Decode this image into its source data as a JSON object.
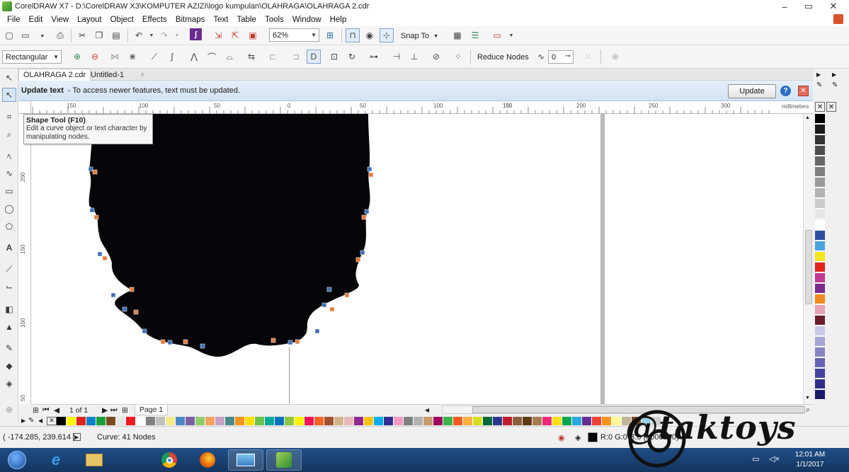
{
  "window": {
    "title": "CorelDRAW X7 - D:\\CorelDRAW X3\\KOMPUTER  AZIZI\\logo kumpulan\\OLAHRAGA\\OLAHRAGA 2.cdr",
    "controls": [
      "–",
      "▭",
      "✕"
    ]
  },
  "menu": [
    "File",
    "Edit",
    "View",
    "Layout",
    "Object",
    "Effects",
    "Bitmaps",
    "Text",
    "Table",
    "Tools",
    "Window",
    "Help"
  ],
  "toolbar": {
    "zoom": "62%",
    "snap_to": "Snap To"
  },
  "property_bar": {
    "node_type": "Rectangular",
    "reduce_nodes": "Reduce Nodes",
    "smoothness": "0"
  },
  "document_tabs": [
    "OLAHRAGA 2.cdr",
    "Untitled-1"
  ],
  "infobar": {
    "title": "Update text",
    "message": "-  To access newer features, text must be updated.",
    "button": "Update"
  },
  "rulers": {
    "unit": "millimeters",
    "h_labels": [
      "150",
      "100",
      "50",
      "0",
      "50",
      "100",
      "150",
      "200",
      "250",
      "300"
    ],
    "v_labels": [
      "200",
      "150",
      "100",
      "50"
    ]
  },
  "tooltip": {
    "title": "Shape Tool (F10)",
    "body": "Edit a curve object or text character by manipulating nodes."
  },
  "pages": {
    "counter": "1 of 1",
    "tab": "Page 1"
  },
  "status": {
    "coordinates": "( -174.285, 239.614 )",
    "object_info": "Curve: 41 Nodes",
    "fill_info": "R:0 G:0 B:0 (#000000)"
  },
  "palette_colors": [
    "#000000",
    "#ffff00",
    "#e2231a",
    "#0082c8",
    "#1a9e3a",
    "#7a4a1e",
    "#e6e6e6",
    "#ed1c24",
    "#ffffff",
    "#808080",
    "#c0c0c0",
    "#f5e98a",
    "#4b87c5",
    "#7b5fa5",
    "#8fcc6b",
    "#f4a460",
    "#c8a2c8",
    "#4a8a8a",
    "#f7941d",
    "#ffdd00",
    "#6cc24a",
    "#00a79d",
    "#0072bc",
    "#8dc63f",
    "#fff200",
    "#ed145b",
    "#f26522",
    "#a0522d",
    "#d2b48c",
    "#e6b8b7",
    "#92278f",
    "#ffc20e",
    "#00aeef",
    "#2e3192",
    "#f49ac2",
    "#7f7f7f",
    "#b2b2b2",
    "#c69c6d",
    "#9e005d",
    "#39b54a",
    "#f15a24",
    "#fbb040",
    "#d7df23",
    "#006838",
    "#2b388f",
    "#be1e2d",
    "#8b5e3c",
    "#603913",
    "#a67c52",
    "#ee2a7b",
    "#ffde17",
    "#00a651",
    "#27aae1",
    "#662d91",
    "#ef4136",
    "#f7941d",
    "#fff799",
    "#c2b59b",
    "#754c24",
    "#9bd1e8",
    "#cfcfcf"
  ],
  "side_palette": [
    "#000000",
    "#1a1a1a",
    "#333333",
    "#4d4d4d",
    "#666666",
    "#808080",
    "#999999",
    "#b3b3b3",
    "#cccccc",
    "#e6e6e6",
    "#ffffff",
    "#2b4ea2",
    "#4aa3df",
    "#f4e61e",
    "#e1251b",
    "#c0398f",
    "#7a2b8e",
    "#f18a1f",
    "#e6a1b5",
    "#6b1e2b",
    "#c9c9e8",
    "#a7a7d6",
    "#8585c4",
    "#6464b3",
    "#4444a0",
    "#2e2e8a",
    "#1b1b6d"
  ],
  "watermark": "@taktoys",
  "clock": [
    "12:01 AM",
    "1/1/2017"
  ]
}
